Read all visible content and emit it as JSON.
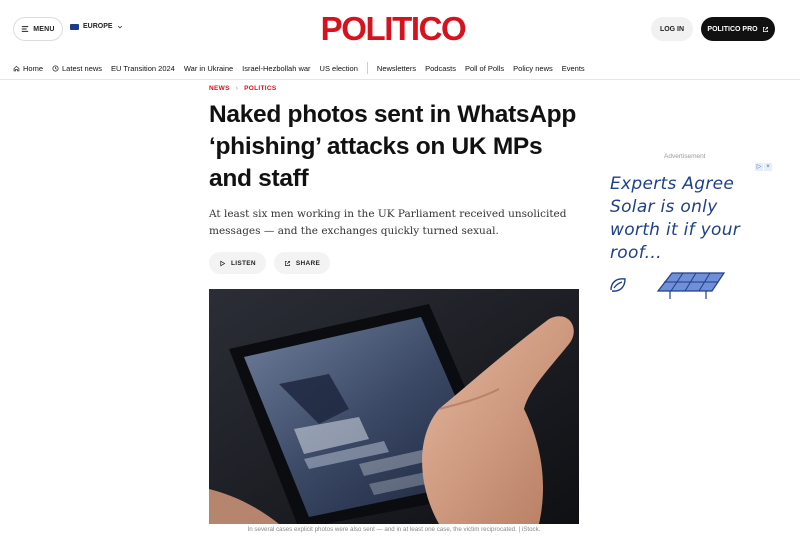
{
  "header": {
    "menu_label": "MENU",
    "edition_label": "EUROPE",
    "logo_text": "POLITICO",
    "login_label": "LOG IN",
    "pro_label": "POLITICO PRO",
    "brand_color": "#d6121f"
  },
  "nav": {
    "items": [
      {
        "label": "Home",
        "icon": "home-icon"
      },
      {
        "label": "Latest news",
        "icon": "clock-icon"
      },
      {
        "label": "EU Transition 2024"
      },
      {
        "label": "War in Ukraine"
      },
      {
        "label": "Israel-Hezbollah war"
      },
      {
        "label": "US election"
      },
      {
        "label": "Newsletters"
      },
      {
        "label": "Podcasts"
      },
      {
        "label": "Poll of Polls"
      },
      {
        "label": "Policy news"
      },
      {
        "label": "Events"
      }
    ]
  },
  "article": {
    "breadcrumb": [
      "NEWS",
      "POLITICS"
    ],
    "headline": "Naked photos sent in WhatsApp ‘phishing’ attacks on UK MPs and staff",
    "dek": "At least six men working in the UK Parliament received unsolicited messages — and the exchanges quickly turned sexual.",
    "listen_label": "LISTEN",
    "share_label": "SHARE",
    "image_caption": "In several cases explicit photos were also sent — and in at least one case, the victim reciprocated. | iStock."
  },
  "ad": {
    "label": "Advertisement",
    "text": "Experts Agree Solar is only worth it if your roof..."
  }
}
